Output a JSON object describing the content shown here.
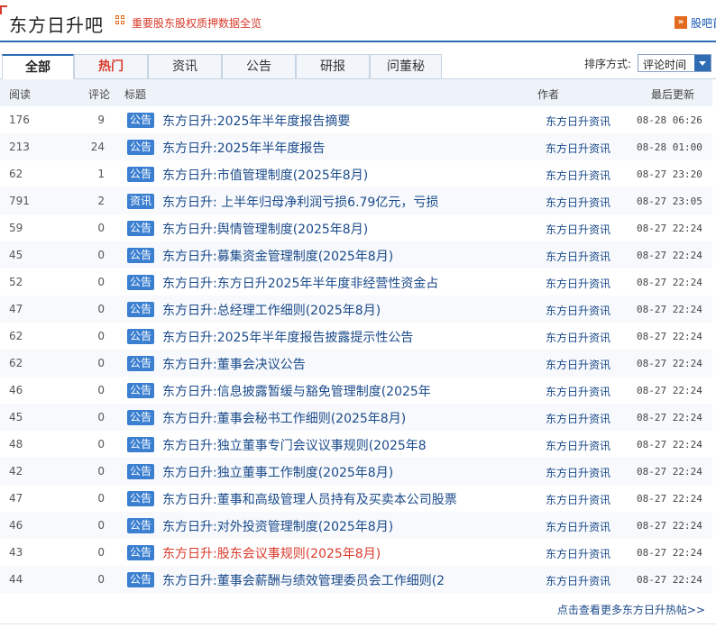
{
  "header": {
    "title": "东方日升吧",
    "pledge_link": "重要股东股权质押数据全览",
    "guide_icon": "»",
    "guide_link": "股吧首"
  },
  "tabs": [
    "全部",
    "热门",
    "资讯",
    "公告",
    "研报",
    "问董秘"
  ],
  "sort": {
    "label": "排序方式:",
    "value": "评论时间"
  },
  "columns": {
    "reads": "阅读",
    "comments": "评论",
    "title": "标题",
    "author": "作者",
    "updated": "最后更新"
  },
  "rows": [
    {
      "reads": "176",
      "comments": "9",
      "badge": "公告",
      "title": "东方日升:2025年半年度报告摘要",
      "author": "东方日升资讯",
      "updated": "08-28 06:26"
    },
    {
      "reads": "213",
      "comments": "24",
      "badge": "公告",
      "title": "东方日升:2025年半年度报告",
      "author": "东方日升资讯",
      "updated": "08-28 01:00"
    },
    {
      "reads": "62",
      "comments": "1",
      "badge": "公告",
      "title": "东方日升:市值管理制度(2025年8月)",
      "author": "东方日升资讯",
      "updated": "08-27 23:20"
    },
    {
      "reads": "791",
      "comments": "2",
      "badge": "资讯",
      "title": "东方日升: 上半年归母净利润亏损6.79亿元，亏损",
      "author": "东方日升资讯",
      "updated": "08-27 23:05"
    },
    {
      "reads": "59",
      "comments": "0",
      "badge": "公告",
      "title": "东方日升:舆情管理制度(2025年8月)",
      "author": "东方日升资讯",
      "updated": "08-27 22:24"
    },
    {
      "reads": "45",
      "comments": "0",
      "badge": "公告",
      "title": "东方日升:募集资金管理制度(2025年8月)",
      "author": "东方日升资讯",
      "updated": "08-27 22:24"
    },
    {
      "reads": "52",
      "comments": "0",
      "badge": "公告",
      "title": "东方日升:东方日升2025年半年度非经营性资金占",
      "author": "东方日升资讯",
      "updated": "08-27 22:24"
    },
    {
      "reads": "47",
      "comments": "0",
      "badge": "公告",
      "title": "东方日升:总经理工作细则(2025年8月)",
      "author": "东方日升资讯",
      "updated": "08-27 22:24"
    },
    {
      "reads": "62",
      "comments": "0",
      "badge": "公告",
      "title": "东方日升:2025年半年度报告披露提示性公告",
      "author": "东方日升资讯",
      "updated": "08-27 22:24"
    },
    {
      "reads": "62",
      "comments": "0",
      "badge": "公告",
      "title": "东方日升:董事会决议公告",
      "author": "东方日升资讯",
      "updated": "08-27 22:24"
    },
    {
      "reads": "46",
      "comments": "0",
      "badge": "公告",
      "title": "东方日升:信息披露暂缓与豁免管理制度(2025年",
      "author": "东方日升资讯",
      "updated": "08-27 22:24"
    },
    {
      "reads": "45",
      "comments": "0",
      "badge": "公告",
      "title": "东方日升:董事会秘书工作细则(2025年8月)",
      "author": "东方日升资讯",
      "updated": "08-27 22:24"
    },
    {
      "reads": "48",
      "comments": "0",
      "badge": "公告",
      "title": "东方日升:独立董事专门会议议事规则(2025年8",
      "author": "东方日升资讯",
      "updated": "08-27 22:24"
    },
    {
      "reads": "42",
      "comments": "0",
      "badge": "公告",
      "title": "东方日升:独立董事工作制度(2025年8月)",
      "author": "东方日升资讯",
      "updated": "08-27 22:24"
    },
    {
      "reads": "47",
      "comments": "0",
      "badge": "公告",
      "title": "东方日升:董事和高级管理人员持有及买卖本公司股票",
      "author": "东方日升资讯",
      "updated": "08-27 22:24"
    },
    {
      "reads": "46",
      "comments": "0",
      "badge": "公告",
      "title": "东方日升:对外投资管理制度(2025年8月)",
      "author": "东方日升资讯",
      "updated": "08-27 22:24"
    },
    {
      "reads": "43",
      "comments": "0",
      "badge": "公告",
      "title": "东方日升:股东会议事规则(2025年8月)",
      "author": "东方日升资讯",
      "updated": "08-27 22:24",
      "highlight": true
    },
    {
      "reads": "44",
      "comments": "0",
      "badge": "公告",
      "title": "东方日升:董事会薪酬与绩效管理委员会工作细则(2",
      "author": "东方日升资讯",
      "updated": "08-27 22:24"
    }
  ],
  "more_link": "点击查看更多东方日升热帖>>",
  "colors": {
    "accent": "#2e6db4",
    "hot": "#d93a2b",
    "badge": "#3b7fd1",
    "link": "#1a4a8a"
  }
}
